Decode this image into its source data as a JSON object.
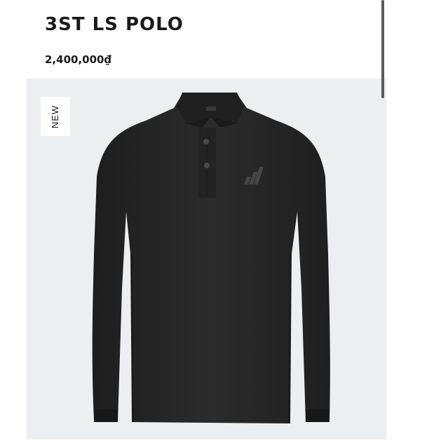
{
  "product": {
    "title": "3ST LS POLO",
    "price": "2,400,000₫",
    "badge": "NEW",
    "image_icon": "shirt-image"
  },
  "colors": {
    "panel_background": "#eceef0",
    "shirt": "#262626",
    "text": "#1a1a1a"
  }
}
